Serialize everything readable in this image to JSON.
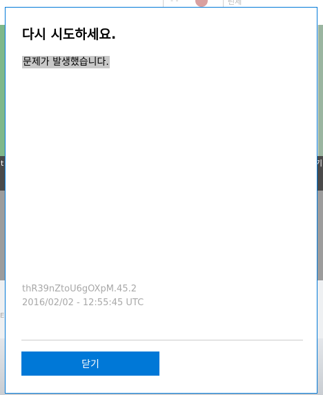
{
  "background": {
    "top_right_text": "린세",
    "top_mid_text": "- -",
    "left_edge_char": "t",
    "right_edge_char": "기",
    "left_lower_char": "E"
  },
  "dialog": {
    "title": "다시 시도하세요.",
    "message": "문제가 발생했습니다.",
    "error_code": "thR39nZtoU6gOXpM.45.2",
    "timestamp": "2016/02/02 - 12:55:45 UTC",
    "close_label": "닫기"
  },
  "colors": {
    "accent": "#0078d7",
    "message_highlight": "#c8c8c8",
    "muted_text": "#a8a8a8"
  }
}
